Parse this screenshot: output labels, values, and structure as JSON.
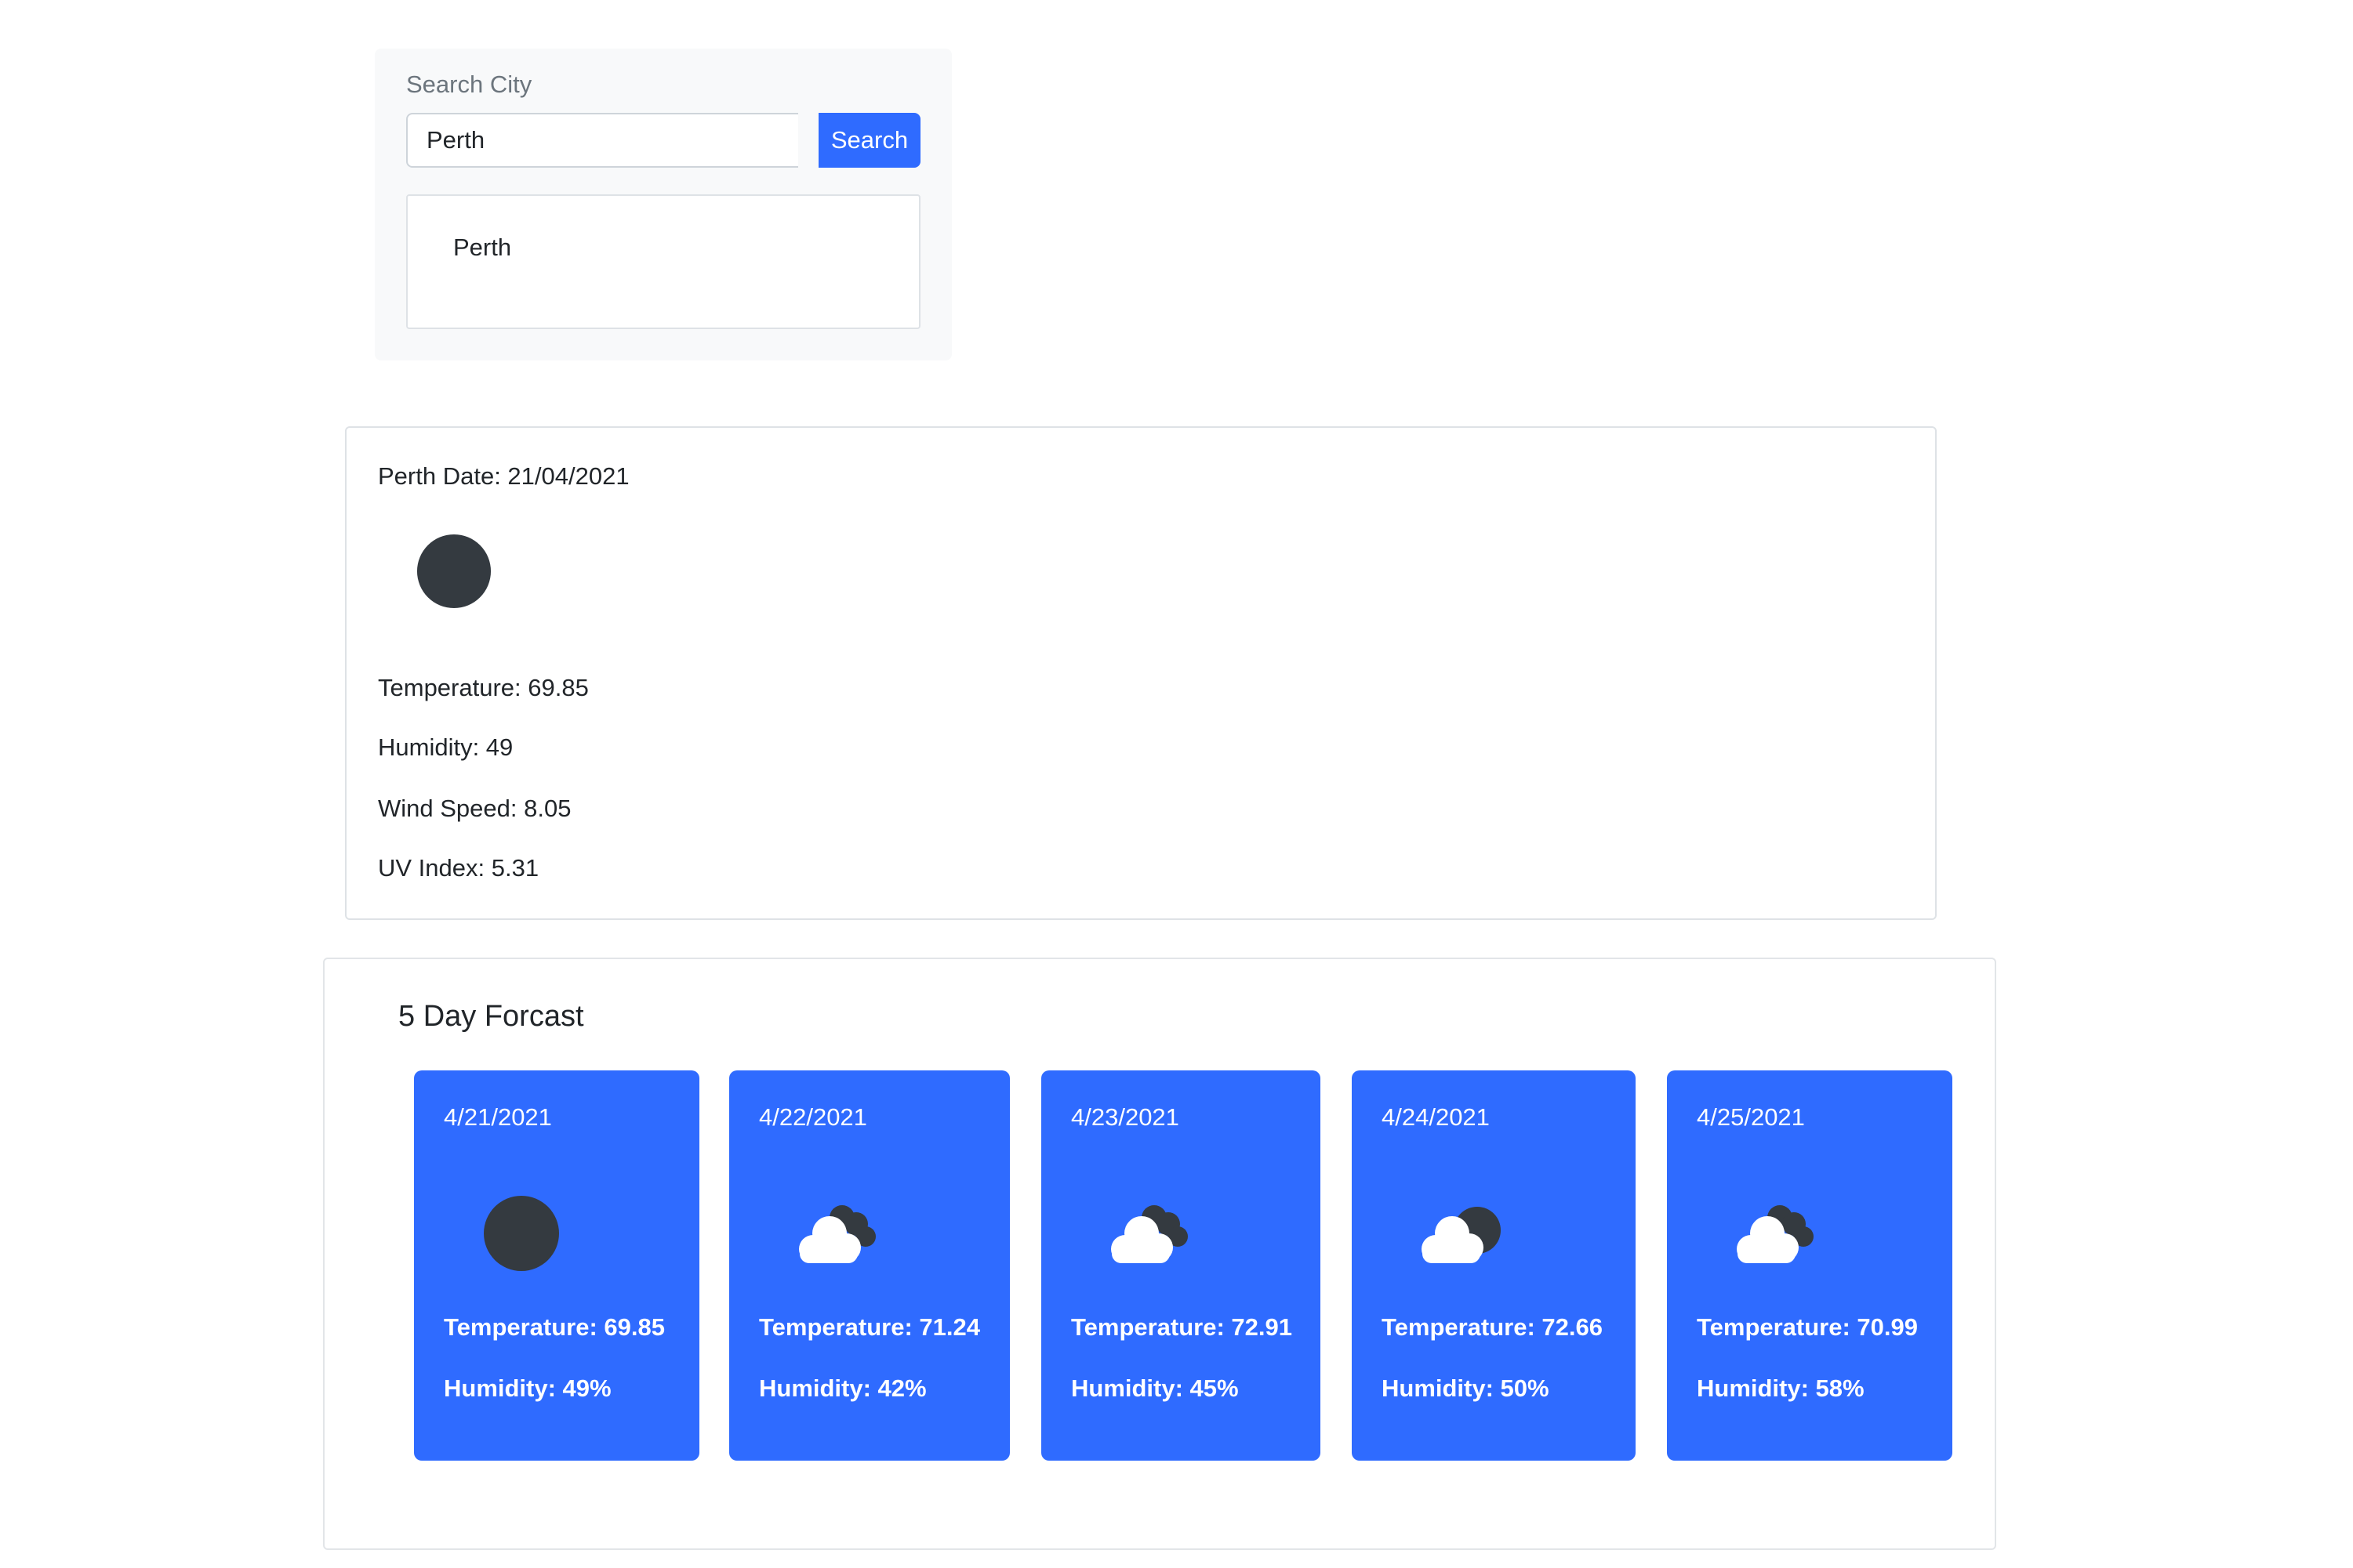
{
  "search": {
    "label": "Search City",
    "value": "Perth",
    "button_label": "Search",
    "history": [
      "Perth"
    ]
  },
  "current": {
    "heading": "Perth Date: 21/04/2021",
    "icon": "moon-icon",
    "temperature": "Temperature: 69.85",
    "humidity": "Humidity: 49",
    "wind_speed": "Wind Speed: 8.05",
    "uv_index": "UV Index: 5.31"
  },
  "forecast": {
    "title": "5 Day Forcast",
    "days": [
      {
        "date": "4/21/2021",
        "icon": "moon-icon",
        "temperature": "Temperature: 69.85",
        "humidity": "Humidity: 49%"
      },
      {
        "date": "4/22/2021",
        "icon": "cloudy-night-icon",
        "temperature": "Temperature: 71.24",
        "humidity": "Humidity: 42%"
      },
      {
        "date": "4/23/2021",
        "icon": "cloudy-night-icon",
        "temperature": "Temperature: 72.91",
        "humidity": "Humidity: 45%"
      },
      {
        "date": "4/24/2021",
        "icon": "partly-cloudy-night-icon",
        "temperature": "Temperature: 72.66",
        "humidity": "Humidity: 50%"
      },
      {
        "date": "4/25/2021",
        "icon": "cloudy-night-icon",
        "temperature": "Temperature: 70.99",
        "humidity": "Humidity: 58%"
      }
    ]
  },
  "colors": {
    "accent": "#2f6bff",
    "icon_dark": "#343a40",
    "cloud_white": "#ffffff"
  }
}
